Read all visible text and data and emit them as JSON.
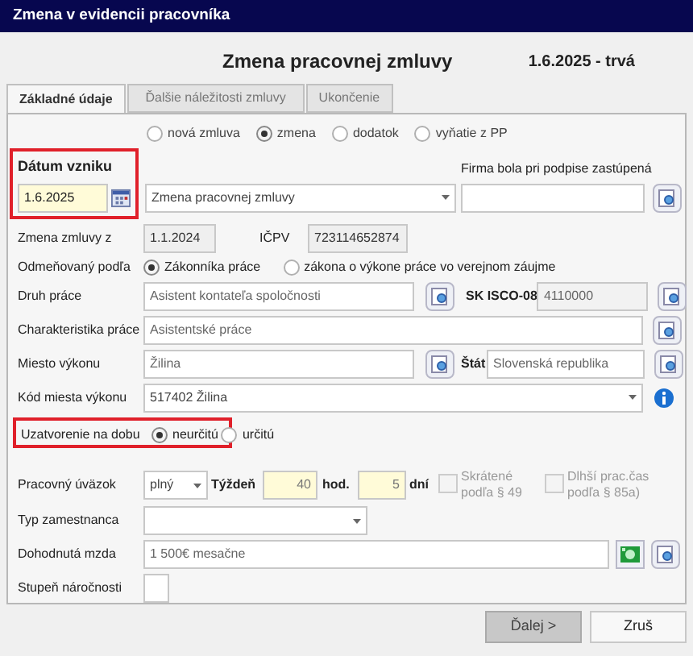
{
  "window": {
    "title": "Zmena v evidencii pracovníka"
  },
  "header": {
    "title": "Zmena pracovnej zmluvy",
    "period": "1.6.2025 - trvá"
  },
  "tabs": [
    {
      "label": "Základné údaje",
      "selected": true
    },
    {
      "label": "Ďalšie náležitosti zmluvy",
      "selected": false
    },
    {
      "label": "Ukončenie",
      "selected": false
    }
  ],
  "contract_type": [
    {
      "label": "nová zmluva",
      "selected": false
    },
    {
      "label": "zmena",
      "selected": true
    },
    {
      "label": "dodatok",
      "selected": false
    },
    {
      "label": "vyňatie z PP",
      "selected": false
    }
  ],
  "start_date": {
    "label": "Dátum vzniku",
    "value": "1.6.2025",
    "highlighted": true
  },
  "document_type": {
    "value": "Zmena pracovnej zmluvy"
  },
  "represented": {
    "label": "Firma bola pri podpise zastúpená"
  },
  "change_of": {
    "label": "Zmena zmluvy z",
    "value": "1.1.2024"
  },
  "icpv": {
    "label": "IČPV",
    "value": "723114652874"
  },
  "remuneration": {
    "label": "Odmeňovaný podľa",
    "options": [
      {
        "label": "Zákonníka práce",
        "selected": true
      },
      {
        "label": "zákona o výkone práce vo verejnom záujme",
        "selected": false
      }
    ]
  },
  "work_type": {
    "label": "Druh práce",
    "value": "Asistent kontateľa spoločnosti",
    "isco_label": "SK ISCO-08",
    "isco_value": "4110000"
  },
  "work_description": {
    "label": "Charakteristika práce",
    "value": "Asistentské práce"
  },
  "workplace": {
    "label": "Miesto výkonu",
    "value": "Žilina",
    "country_label": "Štát",
    "country_value": "Slovenská republika"
  },
  "workplace_code": {
    "label": "Kód miesta výkonu",
    "value": "517402 Žilina"
  },
  "duration": {
    "label": "Uzatvorenie na dobu",
    "highlighted": true,
    "options": [
      {
        "label": "neurčitú",
        "selected": true
      },
      {
        "label": "určitú",
        "selected": false
      }
    ]
  },
  "workload": {
    "label": "Pracovný úväzok",
    "type": "plný",
    "week_label": "Týždeň",
    "hours": "40",
    "hours_unit": "hod.",
    "days": "5",
    "days_unit": "dní",
    "checkboxes": [
      {
        "label": "Skrátené podľa § 49",
        "checked": false,
        "disabled": true
      },
      {
        "label": "Dlhší prac.čas podľa § 85a)",
        "checked": false,
        "disabled": true
      }
    ]
  },
  "employee_type": {
    "label": "Typ zamestnanca"
  },
  "wage": {
    "label": "Dohodnutá mzda",
    "value": "1 500€ mesačne"
  },
  "difficulty": {
    "label": "Stupeň náročnosti"
  },
  "buttons": [
    {
      "label": "Ďalej >",
      "kind": "default"
    },
    {
      "label": "Zruš",
      "kind": "normal"
    }
  ]
}
